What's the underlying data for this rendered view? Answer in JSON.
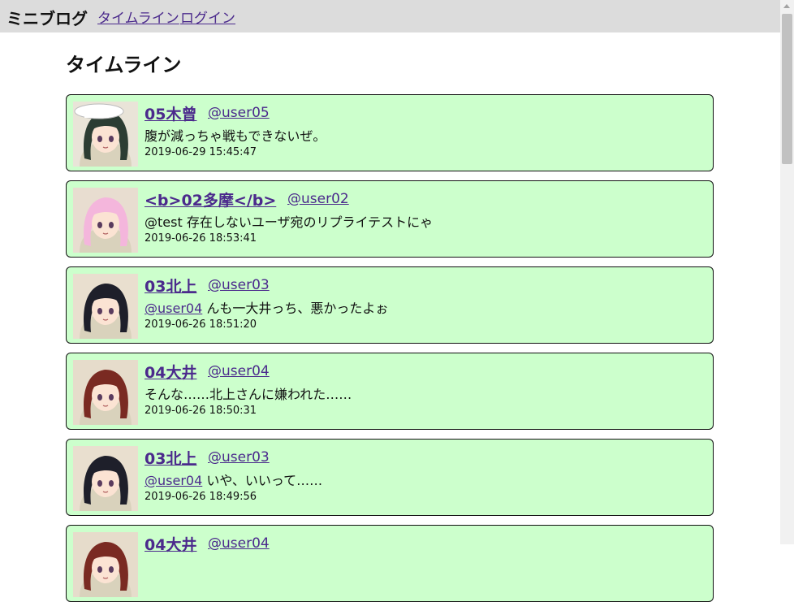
{
  "header": {
    "brand": "ミニブログ",
    "nav": [
      "タイムライン",
      "ログイン"
    ]
  },
  "page_title": "タイムライン",
  "posts": [
    {
      "name": "05木曾",
      "handle": "@user05",
      "mention": "",
      "text": "腹が減っちゃ戦もできないぜ。",
      "time": "2019-06-29 15:45:47",
      "avatar": {
        "icon": "avatar-user05",
        "hair": "#2c3d33",
        "bg": "#e9e4d8",
        "hat": "#ffffff"
      }
    },
    {
      "name": "<b>02多摩</b>",
      "handle": "@user02",
      "mention": "",
      "text": "@test 存在しないユーザ宛のリプライテストにゃ",
      "time": "2019-06-26 18:53:41",
      "avatar": {
        "icon": "avatar-user02",
        "hair": "#f4b6dc",
        "bg": "#e8ddd0",
        "hat": ""
      }
    },
    {
      "name": "03北上",
      "handle": "@user03",
      "mention": "@user04",
      "text": " んも一大井っち、悪かったよぉ",
      "time": "2019-06-26 18:51:20",
      "avatar": {
        "icon": "avatar-user03",
        "hair": "#1e1f2a",
        "bg": "#e9dfcf",
        "hat": ""
      }
    },
    {
      "name": "04大井",
      "handle": "@user04",
      "mention": "",
      "text": "そんな……北上さんに嫌われた……",
      "time": "2019-06-26 18:50:31",
      "avatar": {
        "icon": "avatar-user04",
        "hair": "#7a2a22",
        "bg": "#e6dccb",
        "hat": ""
      }
    },
    {
      "name": "03北上",
      "handle": "@user03",
      "mention": "@user04",
      "text": " いや、いいって……",
      "time": "2019-06-26 18:49:56",
      "avatar": {
        "icon": "avatar-user03",
        "hair": "#1e1f2a",
        "bg": "#e9dfcf",
        "hat": ""
      }
    },
    {
      "name": "04大井",
      "handle": "@user04",
      "mention": "",
      "text": "",
      "time": "",
      "avatar": {
        "icon": "avatar-user04",
        "hair": "#7a2a22",
        "bg": "#e6dccb",
        "hat": ""
      }
    }
  ]
}
